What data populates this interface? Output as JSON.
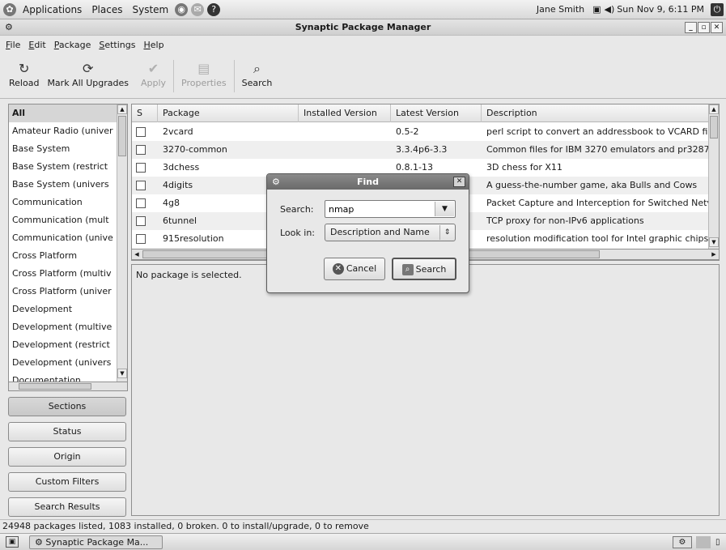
{
  "top_panel": {
    "menus": [
      "Applications",
      "Places",
      "System"
    ],
    "user": "Jane Smith",
    "clock": "Sun Nov  9,  6:11 PM"
  },
  "window": {
    "title": "Synaptic Package Manager"
  },
  "menubar": [
    "File",
    "Edit",
    "Package",
    "Settings",
    "Help"
  ],
  "toolbar": {
    "reload": "Reload",
    "mark_all": "Mark All Upgrades",
    "apply": "Apply",
    "properties": "Properties",
    "search": "Search"
  },
  "sections": {
    "items": [
      "All",
      "Amateur Radio (univer",
      "Base System",
      "Base System (restrict",
      "Base System (univers",
      "Communication",
      "Communication (mult",
      "Communication (unive",
      "Cross Platform",
      "Cross Platform (multiv",
      "Cross Platform (univer",
      "Development",
      "Development (multive",
      "Development (restrict",
      "Development (univers",
      "Documentation"
    ]
  },
  "side_buttons": {
    "sections": "Sections",
    "status": "Status",
    "origin": "Origin",
    "custom_filters": "Custom Filters",
    "search_results": "Search Results"
  },
  "table": {
    "headers": [
      "S",
      "Package",
      "Installed Version",
      "Latest Version",
      "Description"
    ],
    "rows": [
      {
        "package": "2vcard",
        "installed": "",
        "latest": "0.5-2",
        "description": "perl script to convert an addressbook to VCARD fil"
      },
      {
        "package": "3270-common",
        "installed": "",
        "latest": "3.3.4p6-3.3",
        "description": "Common files for IBM 3270 emulators and pr3287"
      },
      {
        "package": "3dchess",
        "installed": "",
        "latest": "0.8.1-13",
        "description": "3D chess for X11"
      },
      {
        "package": "4digits",
        "installed": "",
        "latest": "",
        "description": "A guess-the-number game, aka Bulls and Cows"
      },
      {
        "package": "4g8",
        "installed": "",
        "latest": "",
        "description": "Packet Capture and Interception for Switched Netv"
      },
      {
        "package": "6tunnel",
        "installed": "",
        "latest": "",
        "description": "TCP proxy for non-IPv6 applications"
      },
      {
        "package": "915resolution",
        "installed": "",
        "latest": "",
        "description": "resolution modification tool for Intel graphic chipse"
      }
    ]
  },
  "details": {
    "text": "No package is selected."
  },
  "statusbar": {
    "text": "24948 packages listed, 1083 installed, 0 broken. 0 to install/upgrade, 0 to remove"
  },
  "taskbar": {
    "task": "Synaptic Package Ma..."
  },
  "find_dialog": {
    "title": "Find",
    "search_label": "Search:",
    "search_value": "nmap",
    "lookin_label": "Look in:",
    "lookin_value": "Description and Name",
    "cancel": "Cancel",
    "search_button": "Search"
  }
}
